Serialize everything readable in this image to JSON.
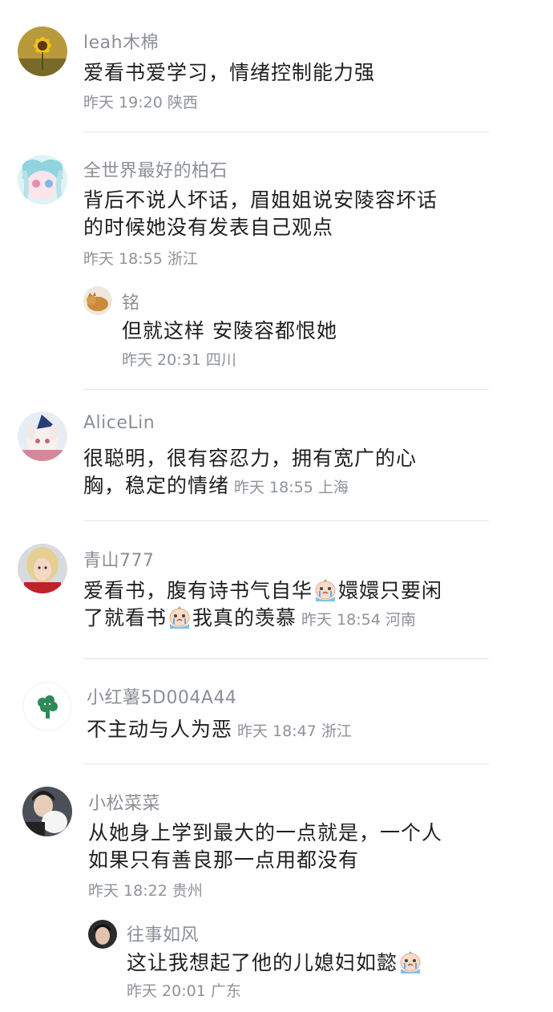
{
  "comments": [
    {
      "user": "leah木棉",
      "avatar_icon": "sunflower-avatar",
      "text": "爱看书爱学习，情绪控制能力强",
      "time": "昨天 19:20 陕西"
    },
    {
      "user": "全世界最好的柏石",
      "avatar_icon": "anime-girl-avatar",
      "text_line1": "背后不说人坏话，眉姐姐说安陵容坏话",
      "text_line2": "的时候她没有发表自己观点",
      "time": "昨天 18:55 浙江",
      "reply": {
        "user": "铭",
        "avatar_icon": "cat-avatar",
        "text": "但就这样 安陵容都恨她",
        "time": "昨天 20:31 四川"
      }
    },
    {
      "user": "AliceLin",
      "avatar_icon": "bunny-plush-avatar",
      "text_line1": "很聪明，很有容忍力，拥有宽广的心",
      "text_line2": "胸，稳定的情绪",
      "time": "昨天 18:55 上海"
    },
    {
      "user": "青山777",
      "avatar_icon": "blonde-girl-avatar",
      "text_line1a": "爱看书，腹有诗书气自华",
      "text_line1b": "嬛嬛只要闲",
      "text_line2a": "了就看书",
      "text_line2b": "我真的羡慕",
      "emoji_icon": "crying-face-emoji",
      "time": "昨天 18:54 河南"
    },
    {
      "user": "小红薯5D004A44",
      "avatar_icon": "broccoli-avatar",
      "text": "不主动与人为恶",
      "time": "昨天 18:47 浙江"
    },
    {
      "user": "小松菜菜",
      "avatar_icon": "man-holding-cat-avatar",
      "text_line1": "从她身上学到最大的一点就是，一个人",
      "text_line2": "如果只有善良那一点用都没有",
      "time": "昨天 18:22 贵州",
      "reply": {
        "user": "往事如风",
        "avatar_icon": "man-portrait-avatar",
        "text": "这让我想起了他的儿媳妇如懿",
        "time": "昨天 20:01 广东"
      }
    }
  ]
}
